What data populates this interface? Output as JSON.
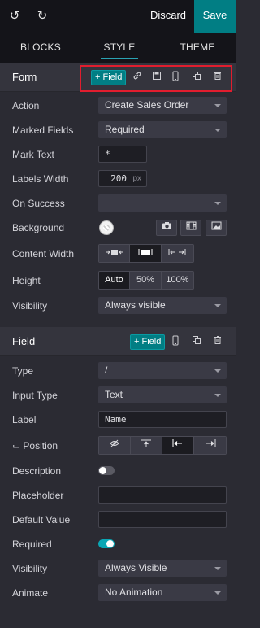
{
  "topbar": {
    "undo_icon": "↺",
    "redo_icon": "↻",
    "discard_label": "Discard",
    "save_label": "Save"
  },
  "tabs": [
    {
      "label": "BLOCKS",
      "active": false
    },
    {
      "label": "STYLE",
      "active": true
    },
    {
      "label": "THEME",
      "active": false
    }
  ],
  "form_section": {
    "title": "Form",
    "add_field_label": "+ Field",
    "rows": {
      "action": {
        "label": "Action",
        "value": "Create Sales Order"
      },
      "marked_fields": {
        "label": "Marked Fields",
        "value": "Required"
      },
      "mark_text": {
        "label": "Mark Text",
        "value": "*"
      },
      "labels_width": {
        "label": "Labels Width",
        "value": "200",
        "unit": "px"
      },
      "on_success": {
        "label": "On Success",
        "value": ""
      },
      "background": {
        "label": "Background"
      },
      "content_width": {
        "label": "Content Width"
      },
      "height": {
        "label": "Height",
        "options": [
          "Auto",
          "50%",
          "100%"
        ],
        "selected": "Auto"
      },
      "visibility": {
        "label": "Visibility",
        "value": "Always visible"
      }
    }
  },
  "field_section": {
    "title": "Field",
    "add_field_label": "+ Field",
    "rows": {
      "type": {
        "label": "Type",
        "value": "/"
      },
      "input_type": {
        "label": "Input Type",
        "value": "Text"
      },
      "label": {
        "label": "Label",
        "value": "Name"
      },
      "position": {
        "label": "⌙ Position"
      },
      "description": {
        "label": "Description",
        "on": false
      },
      "placeholder": {
        "label": "Placeholder",
        "value": ""
      },
      "default_value": {
        "label": "Default Value",
        "value": ""
      },
      "required": {
        "label": "Required",
        "on": true
      },
      "visibility": {
        "label": "Visibility",
        "value": "Always Visible"
      },
      "animate": {
        "label": "Animate",
        "value": "No Animation"
      }
    }
  },
  "colors": {
    "accent": "#017e84",
    "highlight_border": "#e11d2e",
    "toggle_on": "#0aa6b4"
  }
}
